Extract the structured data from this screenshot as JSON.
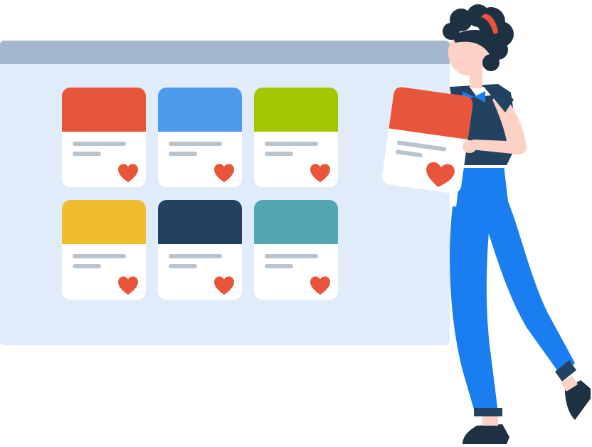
{
  "colors": {
    "window_background": "#e1ecfa",
    "window_titlebar": "#a4b8cd",
    "card_background": "#ffffff",
    "card_text_lines": "#b9c4cf",
    "heart": "#e8553a",
    "jeans": "#1a7ef0",
    "shirt": "#22425f",
    "skin": "#fcd2c7",
    "hair": "#1e3142",
    "headband": "#e8553a"
  },
  "icons": {
    "card_like": "heart-icon",
    "window_bar": "titlebar"
  },
  "cards": [
    {
      "cover_color": "#e8553a"
    },
    {
      "cover_color": "#4d99ea"
    },
    {
      "cover_color": "#a2c600"
    },
    {
      "cover_color": "#f1bd30"
    },
    {
      "cover_color": "#22425f"
    },
    {
      "cover_color": "#52a6b2"
    }
  ],
  "held_card": {
    "cover_color": "#e8553a"
  }
}
